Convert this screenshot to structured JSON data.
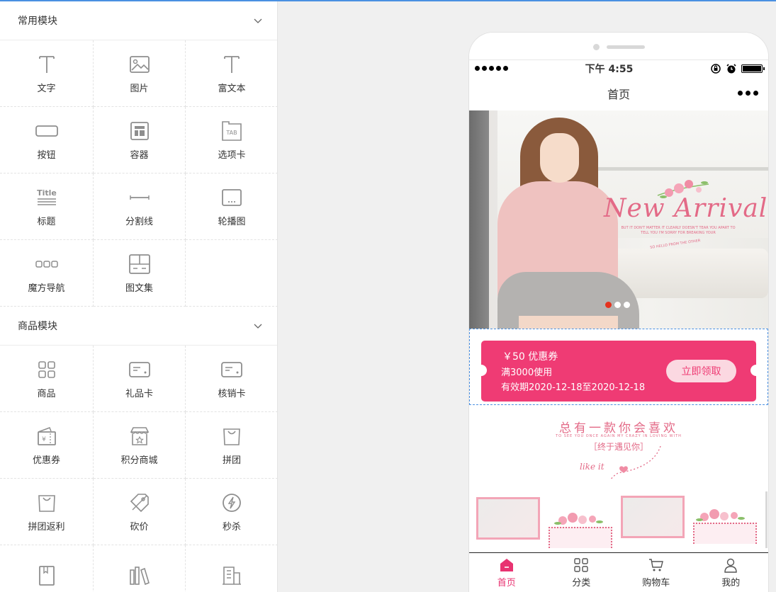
{
  "sections": [
    {
      "title": "常用模块",
      "items": [
        {
          "label": "文字",
          "icon": "text-icon"
        },
        {
          "label": "图片",
          "icon": "image-icon"
        },
        {
          "label": "富文本",
          "icon": "rich-text-icon"
        },
        {
          "label": "按钮",
          "icon": "button-icon"
        },
        {
          "label": "容器",
          "icon": "container-icon"
        },
        {
          "label": "选项卡",
          "icon": "tab-icon"
        },
        {
          "label": "标题",
          "icon": "title-icon"
        },
        {
          "label": "分割线",
          "icon": "divider-icon"
        },
        {
          "label": "轮播图",
          "icon": "carousel-icon"
        },
        {
          "label": "魔方导航",
          "icon": "cube-nav-icon"
        },
        {
          "label": "图文集",
          "icon": "image-text-icon"
        }
      ]
    },
    {
      "title": "商品模块",
      "items": [
        {
          "label": "商品",
          "icon": "goods-icon"
        },
        {
          "label": "礼品卡",
          "icon": "gift-card-icon"
        },
        {
          "label": "核销卡",
          "icon": "verify-card-icon"
        },
        {
          "label": "优惠券",
          "icon": "coupon-icon"
        },
        {
          "label": "积分商城",
          "icon": "points-mall-icon"
        },
        {
          "label": "拼团",
          "icon": "group-buy-icon"
        },
        {
          "label": "拼团返利",
          "icon": "group-rebate-icon"
        },
        {
          "label": "砍价",
          "icon": "bargain-icon"
        },
        {
          "label": "秒杀",
          "icon": "flash-sale-icon"
        },
        {
          "label": "",
          "icon": "book-icon"
        },
        {
          "label": "",
          "icon": "books-icon"
        },
        {
          "label": "",
          "icon": "building-icon"
        }
      ]
    }
  ],
  "phone": {
    "status": {
      "time": "下午 4:55"
    },
    "nav_title": "首页",
    "banner": {
      "title": "New Arrival",
      "tiny_text": "BUT IT DON'T MATTER IT CLEARLY DOESN'T TEAR YOU APART TO TELL YOU I'M SORRY FOR BREAKING YOUR",
      "hello_text": "SO HELLO FROM THE OTHER",
      "active_slide": 0,
      "slide_count": 3
    },
    "coupon": {
      "amount": "￥50 优惠券",
      "condition": "满3000使用",
      "validity": "有效期2020-12-18至2020-12-18",
      "button": "立即领取"
    },
    "promo": {
      "title": "总有一款你会喜欢",
      "subtitle": "TO SEE YOU ONCE AGAIN MY CRAZY IN LOVING WITH",
      "tag": "［终于遇见你］",
      "like": "like it"
    },
    "tabbar": [
      {
        "label": "首页",
        "icon": "home-icon",
        "active": true
      },
      {
        "label": "分类",
        "icon": "category-icon",
        "active": false
      },
      {
        "label": "购物车",
        "icon": "cart-icon",
        "active": false
      },
      {
        "label": "我的",
        "icon": "user-icon",
        "active": false
      }
    ],
    "accent": "#ef3b74"
  }
}
